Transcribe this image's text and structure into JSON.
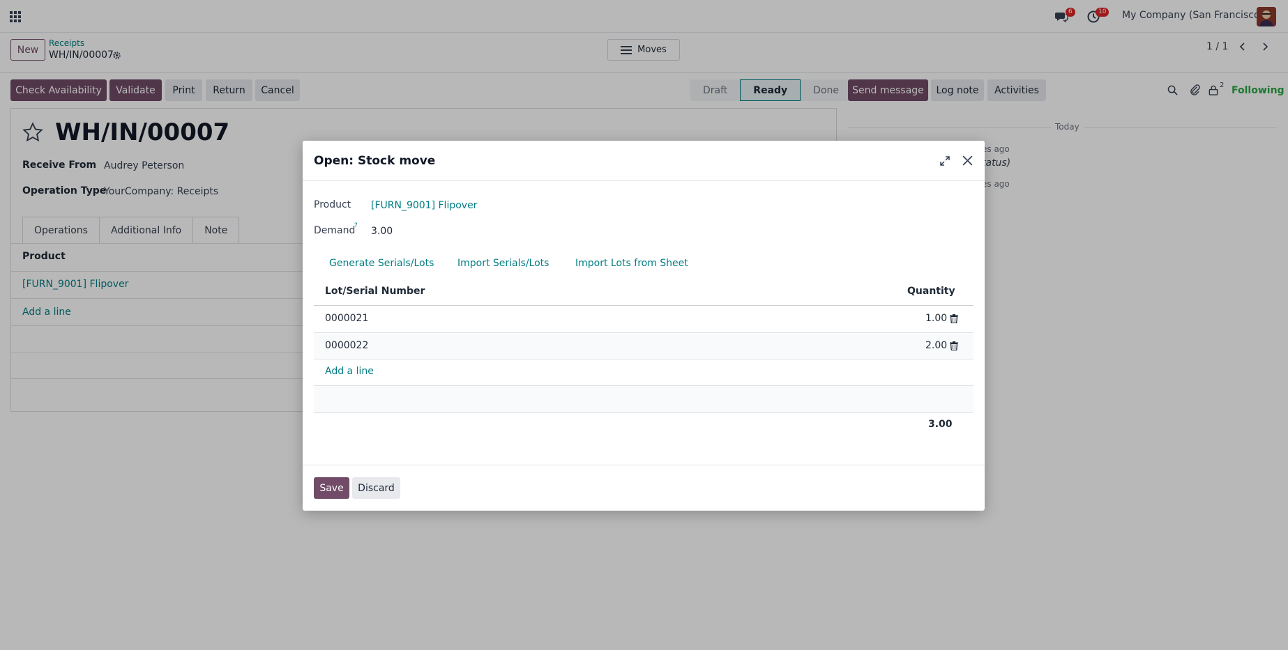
{
  "navbar": {
    "messages_count": "6",
    "activities_count": "10",
    "company": "My Company (San Francisco)"
  },
  "control_panel": {
    "new_label": "New",
    "breadcrumb": "Receipts",
    "record_name": "WH/IN/00007",
    "moves_label": "Moves",
    "pager": "1 / 1"
  },
  "actions": {
    "check_availability": "Check Availability",
    "validate": "Validate",
    "print": "Print",
    "return": "Return",
    "cancel": "Cancel"
  },
  "status": {
    "stages": [
      "Draft",
      "Ready",
      "Done"
    ],
    "active": "Ready"
  },
  "chatter": {
    "send_message": "Send message",
    "log_note": "Log note",
    "activities": "Activities",
    "followers_count": "2",
    "following": "Following",
    "today": "Today",
    "msg1_time": "es ago",
    "msg1_text": "tatus)",
    "msg2_time": "es ago"
  },
  "form": {
    "title": "WH/IN/00007",
    "receive_from_label": "Receive From",
    "receive_from_value": "Audrey Peterson",
    "operation_type_label": "Operation Type",
    "operation_type_value": "YourCompany: Receipts",
    "tabs": [
      "Operations",
      "Additional Info",
      "Note"
    ],
    "product_header": "Product",
    "product_line": "[FURN_9001] Flipover",
    "add_line": "Add a line"
  },
  "modal": {
    "title": "Open: Stock move",
    "product_label": "Product",
    "product_value": "[FURN_9001] Flipover",
    "demand_label": "Demand",
    "demand_help": "?",
    "demand_value": "3.00",
    "generate_serials": "Generate Serials/Lots",
    "import_serials": "Import Serials/Lots",
    "import_sheet": "Import Lots from Sheet",
    "col_lot": "Lot/Serial Number",
    "col_qty": "Quantity",
    "rows": [
      {
        "lot": "0000021",
        "qty": "1.00"
      },
      {
        "lot": "0000022",
        "qty": "2.00"
      }
    ],
    "add_line": "Add a line",
    "total": "3.00",
    "save": "Save",
    "discard": "Discard"
  },
  "colors": {
    "primary": "#714b67",
    "link": "#017e84",
    "badge": "#dc2626",
    "following": "#28a745"
  }
}
